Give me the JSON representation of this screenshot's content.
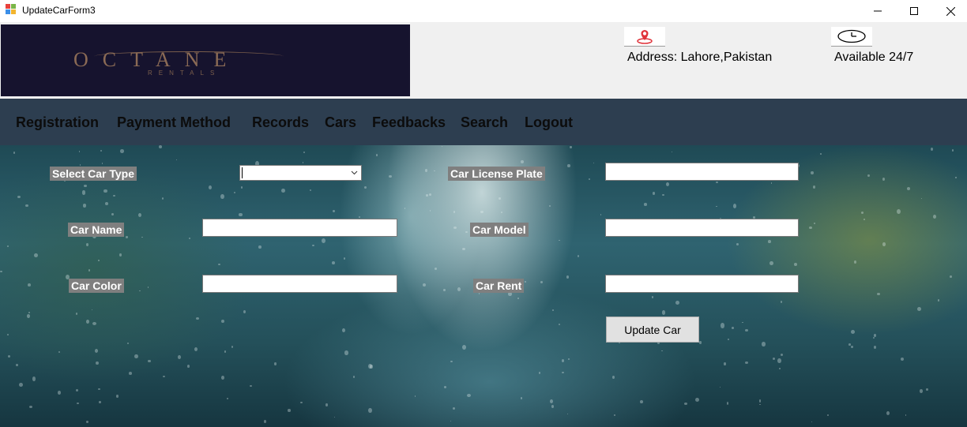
{
  "window": {
    "title": "UpdateCarForm3",
    "controls": {
      "minimize": "minimize-icon",
      "maximize": "maximize-icon",
      "close": "close-icon"
    }
  },
  "header": {
    "logo": {
      "text": "OCTANE",
      "subtext": "RENTALS"
    },
    "address_icon": "map-pin-icon",
    "address_text": "Address: Lahore,Pakistan",
    "hours_icon": "clock-icon",
    "hours_text": "Available 24/7"
  },
  "nav": {
    "items": [
      "Registration",
      "Payment Method",
      "Records",
      "Cars",
      "Feedbacks",
      "Search",
      "Logout"
    ]
  },
  "form": {
    "car_type_label": "Select Car Type",
    "car_type_value": "",
    "license_plate_label": "Car License Plate",
    "license_plate_value": "",
    "car_name_label": "Car Name",
    "car_name_value": "",
    "car_model_label": "Car Model",
    "car_model_value": "",
    "car_color_label": "Car Color",
    "car_color_value": "",
    "car_rent_label": "Car Rent",
    "car_rent_value": "",
    "update_button": "Update Car"
  },
  "colors": {
    "nav_background": "#2d3e50",
    "logo_background": "#16132e",
    "label_background": "#7f7f7f",
    "pin_red": "#e0323a"
  }
}
